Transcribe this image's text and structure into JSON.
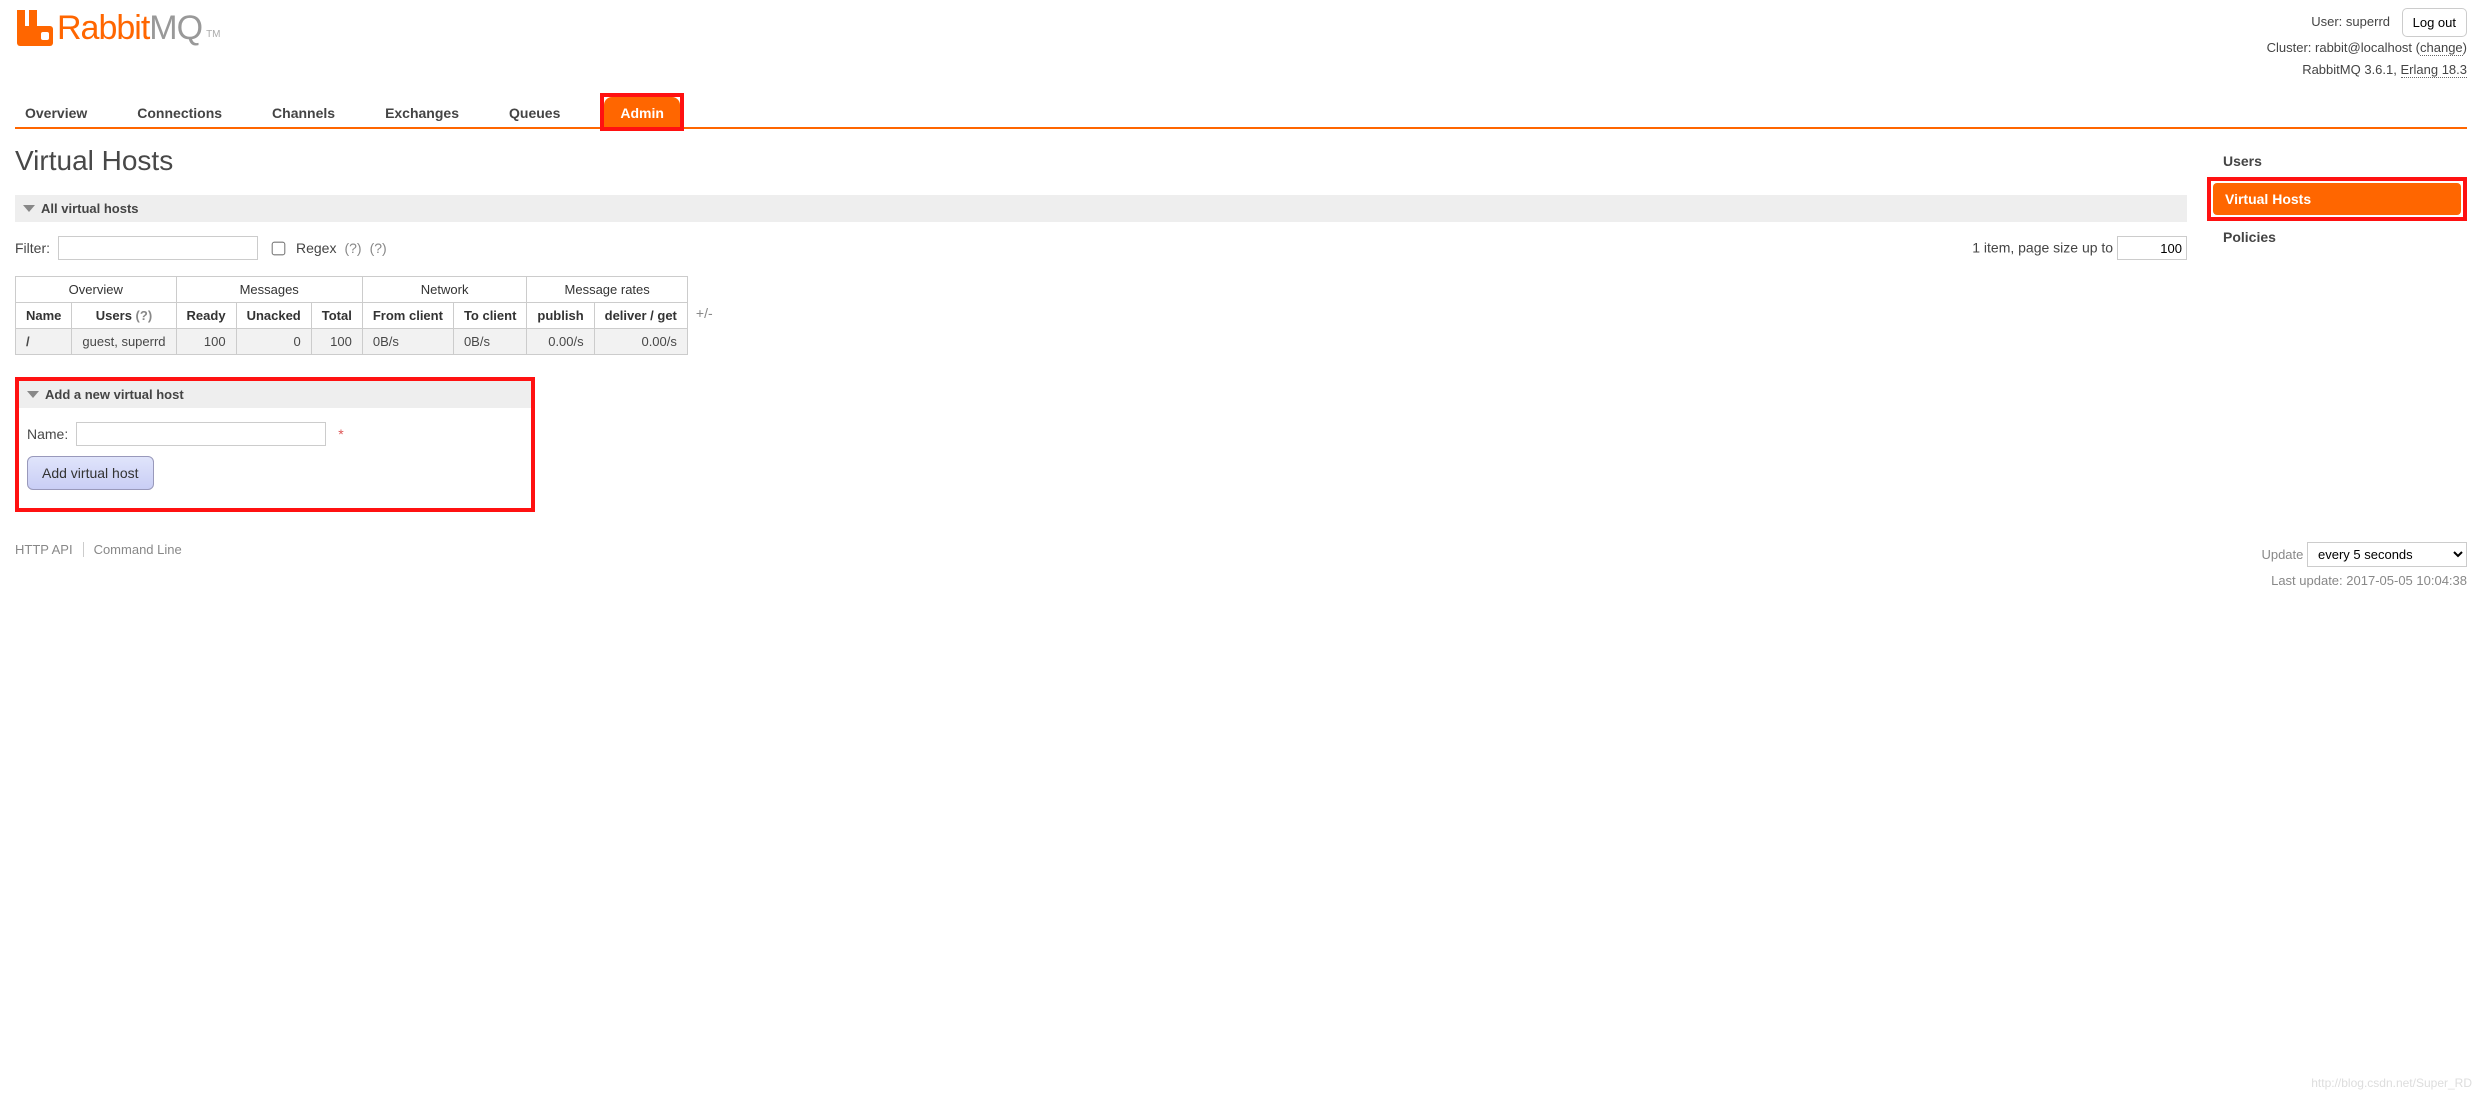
{
  "header": {
    "user_label": "User:",
    "user": "superrd",
    "cluster_label": "Cluster:",
    "cluster": "rabbit@localhost",
    "change_link": "change",
    "version_prefix": "RabbitMQ",
    "version": "3.6.1",
    "erlang_link": "Erlang 18.3",
    "logout": "Log out"
  },
  "tabs": {
    "items": [
      "Overview",
      "Connections",
      "Channels",
      "Exchanges",
      "Queues",
      "Admin"
    ],
    "active": "Admin"
  },
  "page": {
    "title": "Virtual Hosts"
  },
  "sections": {
    "all_vhosts": "All virtual hosts",
    "add_vhost": "Add a new virtual host"
  },
  "filter": {
    "label": "Filter:",
    "value": "",
    "regex_label": "Regex",
    "help1": "(?)",
    "help2": "(?)",
    "item_count_text": "1 item, page size up to",
    "page_size": "100"
  },
  "table": {
    "groups": [
      "Overview",
      "Messages",
      "Network",
      "Message rates"
    ],
    "cols": {
      "name": "Name",
      "users": "Users",
      "users_help": "(?)",
      "ready": "Ready",
      "unacked": "Unacked",
      "total": "Total",
      "from_client": "From client",
      "to_client": "To client",
      "publish": "publish",
      "deliver": "deliver / get"
    },
    "row": {
      "name": "/",
      "users": "guest, superrd",
      "ready": "100",
      "unacked": "0",
      "total": "100",
      "from_client": "0B/s",
      "to_client": "0B/s",
      "publish": "0.00/s",
      "deliver": "0.00/s"
    },
    "plusminus": "+/-"
  },
  "add_form": {
    "name_label": "Name:",
    "name_value": "",
    "required": "*",
    "button": "Add virtual host"
  },
  "sidenav": {
    "items": [
      "Users",
      "Virtual Hosts",
      "Policies"
    ],
    "active": "Virtual Hosts"
  },
  "footer": {
    "api": "HTTP API",
    "cli": "Command Line",
    "update_label": "Update",
    "refresh_selected": "every 5 seconds",
    "last_update_label": "Last update:",
    "last_update": "2017-05-05 10:04:38"
  },
  "watermark": "http://blog.csdn.net/Super_RD"
}
